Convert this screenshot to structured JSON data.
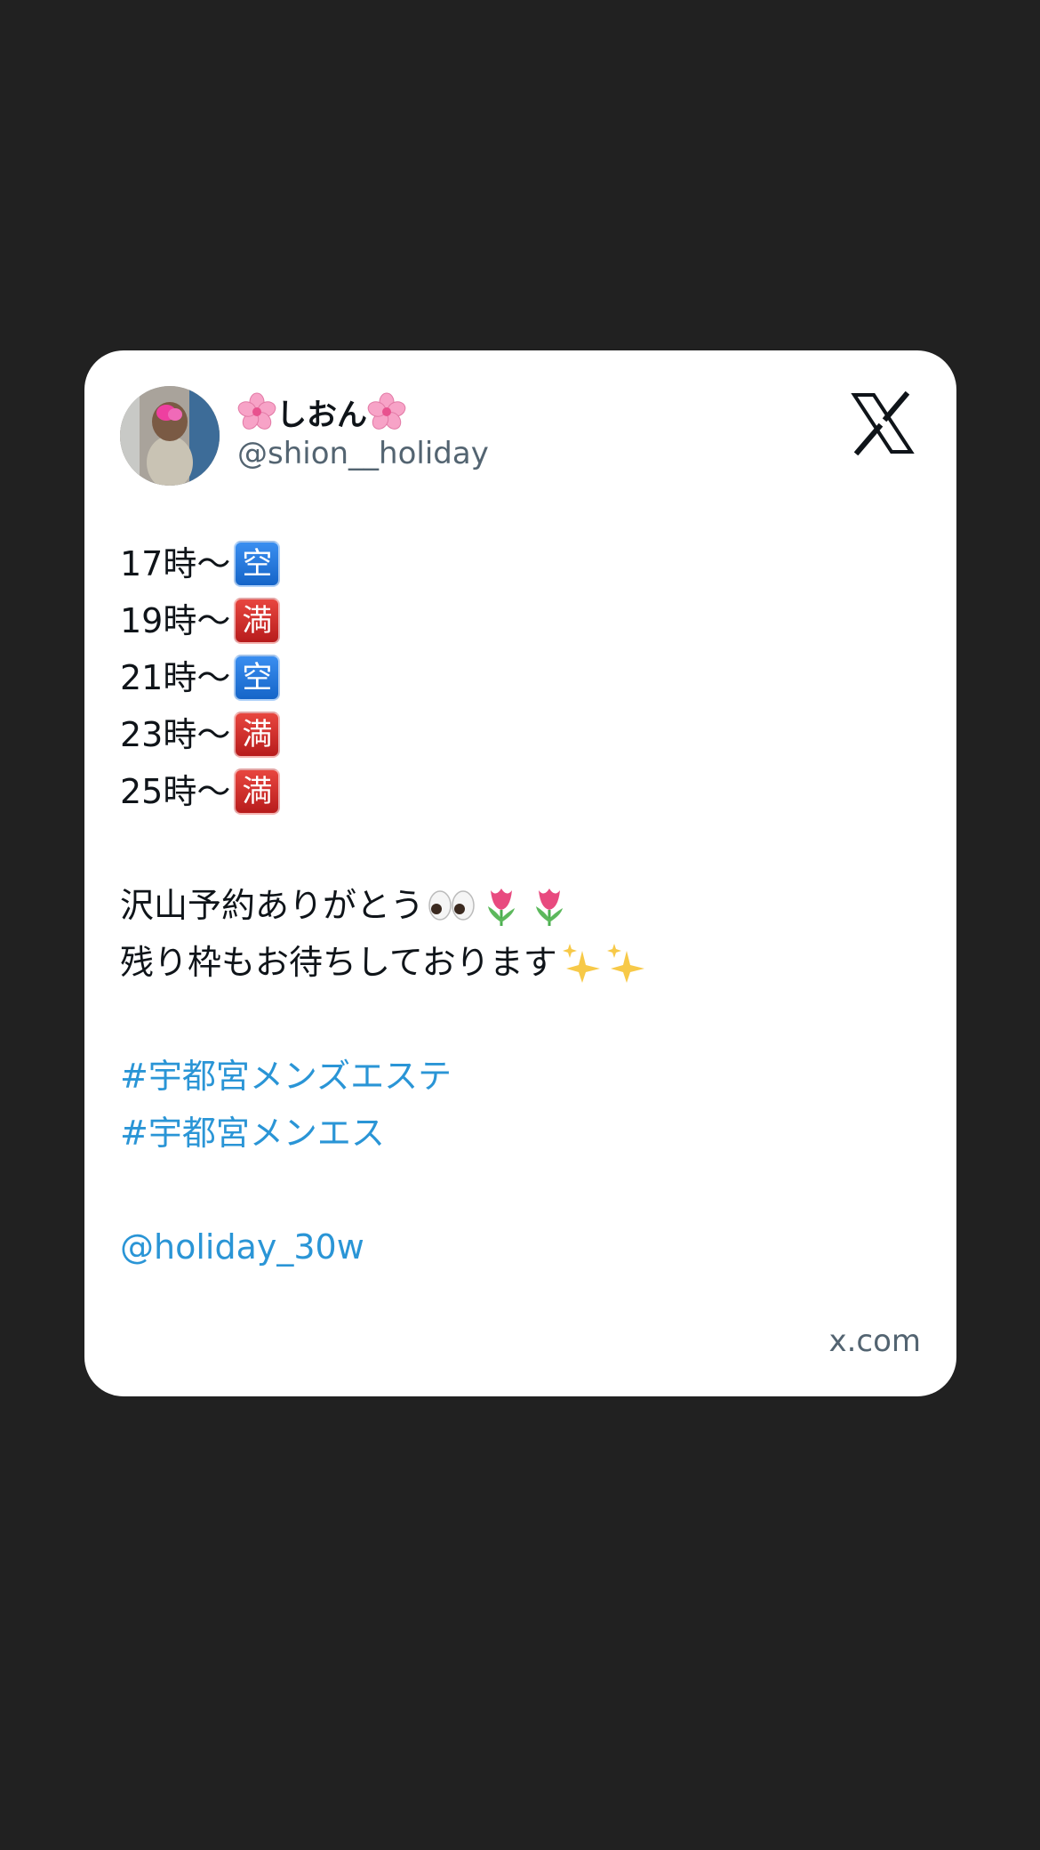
{
  "card": {
    "display_name": "しおん",
    "handle": "@shion__holiday",
    "domain": "x.com"
  },
  "schedule": [
    {
      "time": "17時〜",
      "status": "空",
      "status_color": "#1a73e8"
    },
    {
      "time": "19時〜",
      "status": "満",
      "status_color": "#d32f2f"
    },
    {
      "time": "21時〜",
      "status": "空",
      "status_color": "#1a73e8"
    },
    {
      "time": "23時〜",
      "status": "満",
      "status_color": "#d32f2f"
    },
    {
      "time": "25時〜",
      "status": "満",
      "status_color": "#d32f2f"
    }
  ],
  "message": {
    "line1": "沢山予約ありがとう",
    "line2": "残り枠もお待ちしております"
  },
  "hashtags": [
    "#宇都宮メンズエステ",
    "#宇都宮メンエス"
  ],
  "mention": "@holiday_30w",
  "icons": {
    "display_name_decoration": "cherry-blossom-icon",
    "brand": "x-logo-icon",
    "line1_emoji": [
      "eyes-icon",
      "tulip-icon",
      "tulip-icon"
    ],
    "line2_emoji": [
      "sparkles-icon",
      "sparkles-icon"
    ]
  },
  "colors": {
    "link": "#2a95d6",
    "background": "#212121",
    "card": "#ffffff"
  }
}
